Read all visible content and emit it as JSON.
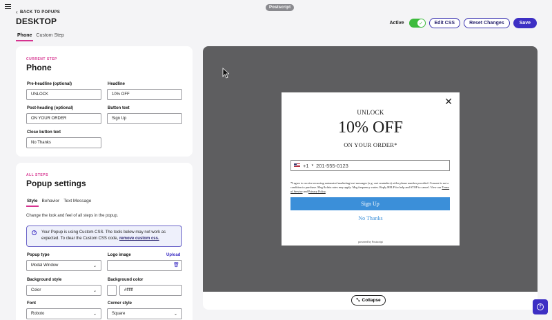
{
  "app": {
    "badge": "Postscript"
  },
  "header": {
    "back_label": "BACK TO POPUPS",
    "title": "DESKTOP",
    "tabs": [
      {
        "label": "Phone",
        "active": true
      },
      {
        "label": "Custom Step",
        "active": false
      }
    ],
    "active_label": "Active",
    "active_on": true,
    "edit_css": "Edit CSS",
    "reset_changes": "Reset Changes",
    "save": "Save"
  },
  "current_step": {
    "eyebrow": "CURRENT STEP",
    "title": "Phone",
    "fields": {
      "pre_headline": {
        "label": "Pre-headline (optional)",
        "value": "UNLOCK"
      },
      "headline": {
        "label": "Headline",
        "value": "10% OFF"
      },
      "post_heading": {
        "label": "Post-heading (optional)",
        "value": "ON YOUR ORDER"
      },
      "button_text": {
        "label": "Button text",
        "value": "Sign Up"
      },
      "close_button_text": {
        "label": "Close button text",
        "value": "No Thanks"
      }
    }
  },
  "settings": {
    "eyebrow": "ALL STEPS",
    "title": "Popup settings",
    "tabs": [
      {
        "label": "Style",
        "active": true
      },
      {
        "label": "Behavior",
        "active": false
      },
      {
        "label": "Text Message",
        "active": false
      }
    ],
    "helper": "Change the look and feel of all steps in the popup.",
    "notice_text": "Your Popup is using Custom CSS. The tools below may not work as expected. To clear the Custom CSS code,",
    "notice_link": "remove custom css.",
    "popup_type": {
      "label": "Popup type",
      "value": "Modal Window"
    },
    "logo_image": {
      "label": "Logo image",
      "upload": "Upload"
    },
    "background_style": {
      "label": "Background style",
      "value": "Color"
    },
    "background_color": {
      "label": "Background color",
      "value": "#ffffff"
    },
    "font": {
      "label": "Font",
      "value": "Roboto"
    },
    "corner_style": {
      "label": "Corner style",
      "value": "Square"
    }
  },
  "preview": {
    "pre_headline": "UNLOCK",
    "headline": "10% OFF",
    "post_heading": "ON YOUR ORDER*",
    "country_code": "+1",
    "phone_placeholder": "201-555-0123",
    "legal_1": "*I agree to receive recurring automated marketing text messages (e.g. cart reminders) at the phone number provided. Consent is not a condition to purchase. Msg & data rates may apply. Msg frequency varies. Reply HELP for help and STOP to cancel. View our",
    "terms": "Terms of Service",
    "and": "and",
    "privacy": "Privacy Policy",
    "button": "Sign Up",
    "close_text": "No Thanks",
    "powered": "powered by Postscript",
    "collapse": "Collapse"
  },
  "colors": {
    "accent": "#3d2fc4",
    "pink": "#d6338f",
    "toggle": "#3dbb3d",
    "popup_button": "#3b8fd9"
  }
}
